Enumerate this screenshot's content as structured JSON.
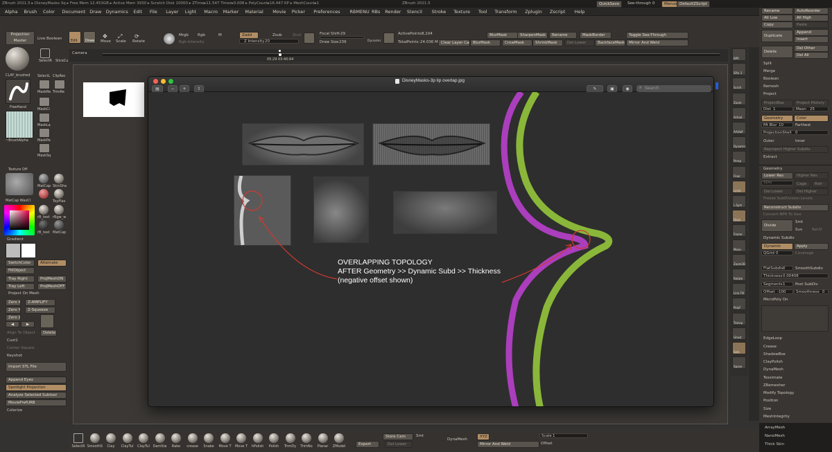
{
  "title_bar": {
    "left": "ZBrush 2021.5 ▸ DisneyMasks-3q  ▸ Free Mem 12.453GB ▸ Active Mem 3930 ▸ Scratch Disk 10000 ▸ ZTime▸11.547 Timer▸0.008 ▸ PolyCount▸16.447 KP ▸ MeshCount▸1",
    "center": "ZBrush 2021.5"
  },
  "top_right": {
    "quicksave": "QuickSave",
    "see_through_label": "See-through",
    "see_through_value": "0",
    "menus": "Menus",
    "default_zscript": "DefaultZScript"
  },
  "menu": [
    "Alpha",
    "Brush",
    "Color",
    "Document",
    "Draw",
    "Dynamics",
    "Edit",
    "File",
    "Layer",
    "Light",
    "Macro",
    "Marker",
    "Material",
    "Movie",
    "Picker",
    "Preferences",
    "RBMENU",
    "RBs",
    "Render",
    "Stencil",
    "Stroke",
    "Texture",
    "Tool",
    "Transform",
    "Zplugin",
    "Zscript",
    "Help"
  ],
  "shelf": {
    "projection_master": "Projection Master",
    "live_boolean": "Live Boolean",
    "edit": "Edit",
    "draw": "Draw",
    "move": "Move",
    "scale": "Scale",
    "rotate": "Rotate",
    "mrgb": "Mrgb",
    "rgb": "Rgb",
    "m": "M",
    "rgb_intensity": "Rgb Intensity",
    "zadd": "Zadd",
    "zsub": "Zsub",
    "zcut": "Zcut",
    "z_intensity_label": "Z Intensity",
    "z_intensity_value": "20",
    "focal_shift_label": "Focal Shift",
    "focal_shift_value": "-29",
    "draw_size_label": "Draw Size",
    "draw_size_value": "239",
    "dynamic": "Dynamic",
    "active_points_label": "ActivePoints:",
    "active_points_value": "8,104",
    "total_points_label": "TotalPoints:",
    "total_points_value": "24.036 Mil",
    "blur_mask": "BlurMask",
    "sharpen_mask": "SharpenMask",
    "rename": "Rename",
    "mask_border": "MaskBorder",
    "toggle_see_through": "Toggle See-Through",
    "clear_layer_cache": "Clear Layer Cac",
    "blur_mask2": "BlurMask",
    "crow_mask": "CrowMask",
    "shrink_mask": "ShrinkMask",
    "del_lower": "Del Lower",
    "backface_mask": "BackfaceMask",
    "mirror_and_weld": "Mirror And Weld"
  },
  "timeline": {
    "label": "Camera",
    "time": "05:29 03:40:64"
  },
  "left_tray": {
    "brush_name": "CLAY_brushed",
    "select_rect": "SelectR",
    "slice_curve": "SliceCu",
    "select_lasso": "SelectL",
    "clip_rect": "ClipRec",
    "mask_rect": "MaskRe",
    "trim_rect": "TrimRe",
    "mask_c": "MaskCi",
    "mask_l": "MaskLa",
    "mask_p": "MaskPe",
    "mask_s": "MaskSq",
    "stroke": "FreeHand",
    "alpha": "~BrushAlpha",
    "texture_off": "Texture Off",
    "matcap_wax": "MatCap WaxCl",
    "matcap": "MatCap",
    "skin_shade": "SkinSha",
    "toyplastic": "ToyPlas",
    "rb_test": "rB_test",
    "rbgw": "rBgw_w",
    "matcap2": "MatCap",
    "gradient": "Gradient",
    "switch_color": "SwitchColor",
    "alternate": "Alternate",
    "fill_object": "FillObject",
    "tray_right": "Tray Right",
    "proj_mesh_on": "ProjMeshON",
    "tray_left": "Tray Left",
    "proj_mesh_off": "ProjMeshOFF",
    "project_on_mesh": "Project On Mesh",
    "zero_x": "Zero X",
    "z_amplify": "Z-AMPLIFY",
    "zero_y": "Zero Y",
    "z_squeeze": "Z-Squeeze",
    "zero_z": "Zero Z",
    "align_to_object": "Align To Object",
    "delete": "Delete",
    "cust1": "Cust1",
    "center_square": "Center Square",
    "keyshot": "Keyshot",
    "import_stl": "Import STL File",
    "append_eyes": "Append Eyes",
    "spotlight_projection": "Spotlight Projection",
    "analyze_subtool": "Analyze Selected Subtool",
    "movie_pref": "MoviePrefURB",
    "colorize": "Colorize"
  },
  "viewer": {
    "filename": "DisneyMasks-3p lip overlap.jpg",
    "search_placeholder": "Search",
    "annotation_line1": "OVERLAPPING TOPOLOGY",
    "annotation_line2": "AFTER Geometry >> Dynamic Subd >> Thickness",
    "annotation_line3": "(negative offset shown)",
    "colors": {
      "ring": "#d0392f",
      "purple": "#b23fc4",
      "green": "#8fbf3a"
    }
  },
  "right_dock": {
    "bpr": "BPR",
    "spix": "SPix 3",
    "scroll": "Scroll",
    "zoom": "Zoom",
    "actual": "Actual",
    "aahalf": "AAHalf",
    "dynamic": "Dynamic",
    "persp": "Persp",
    "floor": "Floor",
    "local": "Local",
    "lsym": "L.Sym",
    "xyz": "Qxyz",
    "frame": "Frame",
    "move": "Move",
    "zoom3d": "Zoom3D",
    "rotate": "Rotate",
    "line_fill": "Line Fill",
    "polyf": "PolyF",
    "transp": "Transp",
    "ghost": "Ghost",
    "solo": "Solo",
    "xpose": "Xpose"
  },
  "subtool_panel": {
    "rename": "Rename",
    "auto_reorder": "AutoReorder",
    "all_low": "All Low",
    "all_high": "All High",
    "copy": "Copy",
    "paste": "Paste",
    "duplicate": "Duplicate",
    "append": "Append",
    "insert": "Insert",
    "delete": "Delete",
    "del_other": "Del Other",
    "del_all": "Del All",
    "split": "Split",
    "merge": "Merge",
    "boolean": "Boolean",
    "remesh": "Remesh",
    "project": "Project",
    "project_bas": "ProjectBas",
    "project_history": "Project History",
    "dist": "Dist",
    "dist_value": "1",
    "mean": "Mean",
    "mean_value": "25",
    "geometry": "Geometry",
    "color": "Color",
    "pa_blur": "PA Blur",
    "pa_blur_value": "10",
    "farthest": "Farthest",
    "projection_shell": "ProjectionShell",
    "projection_shell_value": "0",
    "outer": "Outer",
    "inner": "Inner",
    "reproject_higher": "Reproject Higher Subdiv",
    "extract": "Extract"
  },
  "geometry_panel": {
    "header": "Geometry",
    "lower_res": "Lower Res",
    "higher_res": "Higher Res",
    "sdiv": "SDiv",
    "cage": "Cage",
    "rstr": "Rstr",
    "del_lower": "Del Lower",
    "del_higher": "Del Higher",
    "freeze_subdiv": "Freeze SubDivision Levels",
    "reconstruct_subdiv": "Reconstruct Subdiv",
    "convert_bpr": "Convert BPR To Geo",
    "divide": "Divide",
    "smt": "Smt",
    "suv": "Suv",
    "reuv": "ReUV",
    "dynamic_subdiv": "Dynamic Subdiv",
    "dynamic": "Dynamic",
    "apply": "Apply",
    "qgrid": "QGrid",
    "qgrid_value": "0",
    "coverage": "Coverage",
    "flat_subdiv": "FlatSubdiv",
    "flat_subdiv_value": "0",
    "smooth_subdiv": "SmoothSubdiv",
    "thickness": "Thickness",
    "thickness_value": "0.00408",
    "segments": "Segments",
    "segments_value": "1",
    "post_subdiv": "Post SubDiv",
    "offset": "Offset",
    "offset_value": "-100",
    "smoothness": "Smoothness",
    "smoothness_value": "0",
    "micropoly": "MicroPoly On",
    "edge_loop": "EdgeLoop",
    "crease": "Crease",
    "shadowbox": "ShadowBox",
    "claypolish": "ClayPolish",
    "dynamesh": "DynaMesh",
    "tessimate": "Tessimate",
    "zremesher": "ZRemesher",
    "modify_topology": "Modify Topology",
    "position": "Position",
    "size": "Size",
    "mesh_integrity": "MeshIntegrity",
    "array_mesh": "ArrayMesh",
    "nano_mesh": "NanoMesh",
    "thick_skin": "Thick Skin"
  },
  "bottom_shelf": {
    "brushes": [
      "SelectR",
      "SmoothStandar",
      "Clay",
      "ClayTul",
      "ClayTul",
      "DamSta",
      "Rake",
      "crease",
      "Snake",
      "Move T",
      "Move T",
      "hPolish",
      "Polish",
      "TrimDy",
      "TrimNo",
      "Planar",
      "ZModel"
    ],
    "store_cam": "Store Cam",
    "smt": "Smt",
    "export": "Export",
    "del_lower": "Del Lower",
    "dynamesh": "DynaMesh",
    "xyz": "XYZ",
    "mirror_and_weld": "Mirror And Weld",
    "scale_label": "Scale",
    "scale_value": "1",
    "offset": "Offset"
  }
}
